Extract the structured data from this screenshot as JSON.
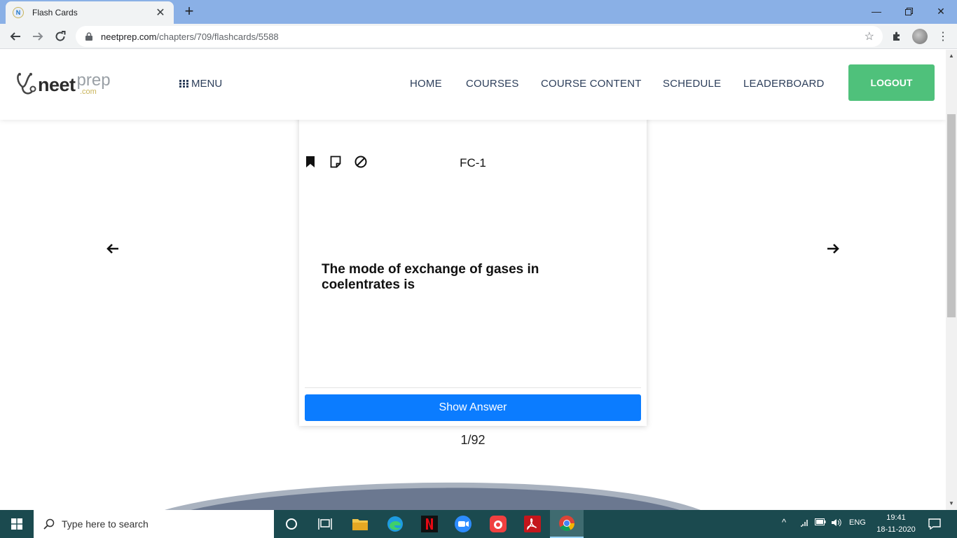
{
  "browser": {
    "tab_title": "Flash Cards",
    "tab_favicon": "N",
    "url_domain": "neetprep.com",
    "url_path": "/chapters/709/flashcards/5588"
  },
  "site": {
    "logo_neet": "neet",
    "logo_prep": "prep",
    "logo_com": ".com",
    "menu_label": "MENU",
    "nav": [
      "HOME",
      "COURSES",
      "COURSE CONTENT",
      "SCHEDULE",
      "LEADERBOARD"
    ],
    "logout_label": "LOGOUT",
    "accent_green": "#4fc17b",
    "accent_blue": "#0b7cff"
  },
  "flashcard": {
    "label": "FC-1",
    "question": "The mode of exchange of gases in coelentrates is",
    "show_answer_label": "Show Answer",
    "counter": "1/92",
    "icons": [
      "bookmark-icon",
      "note-icon",
      "block-icon"
    ]
  },
  "taskbar": {
    "search_placeholder": "Type here to search",
    "language": "ENG",
    "time": "19:41",
    "date": "18-11-2020"
  }
}
